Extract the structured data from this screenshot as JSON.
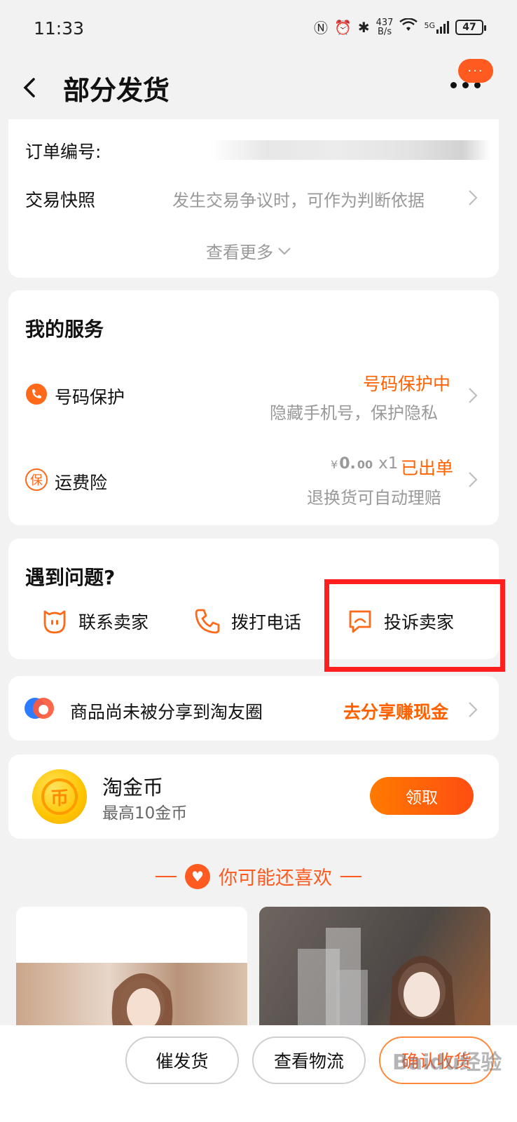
{
  "status_bar": {
    "time": "11:33",
    "net_speed_value": "437",
    "net_speed_unit": "B/s",
    "network": "5G",
    "battery": "47"
  },
  "header": {
    "title": "部分发货",
    "badge_text": "···"
  },
  "order_info": {
    "order_no_label": "订单编号:",
    "snapshot_label": "交易快照",
    "snapshot_hint": "发生交易争议时，可作为判断依据",
    "see_more": "查看更多"
  },
  "services": {
    "title": "我的服务",
    "phone_protect": {
      "label": "号码保护",
      "status": "号码保护中",
      "desc": "隐藏手机号，保护隐私",
      "icon": "phone-shield-icon"
    },
    "shipping_insurance": {
      "label": "运费险",
      "price_symbol": "¥",
      "price_int": "0.",
      "price_dec": "00",
      "qty": "x1",
      "status": "已出单",
      "desc": "退换货可自动理赔",
      "icon": "bao-icon",
      "icon_char": "保"
    }
  },
  "problems": {
    "title": "遇到问题?",
    "contact_seller": "联系卖家",
    "call": "拨打电话",
    "complain": "投诉卖家"
  },
  "share": {
    "text": "商品尚未被分享到淘友圈",
    "action": "去分享赚现金"
  },
  "coins": {
    "title": "淘金币",
    "subtitle": "最高10金币",
    "button": "领取",
    "coin_char": "币"
  },
  "recommend": {
    "title": "你可能还喜欢"
  },
  "bottom": {
    "urge": "催发货",
    "logistics": "查看物流",
    "confirm": "确认收货",
    "watermark": "Baidu经验"
  },
  "colors": {
    "accent": "#ff6200",
    "highlight_box": "#ff1f1f",
    "bg": "#f2f2f2"
  }
}
